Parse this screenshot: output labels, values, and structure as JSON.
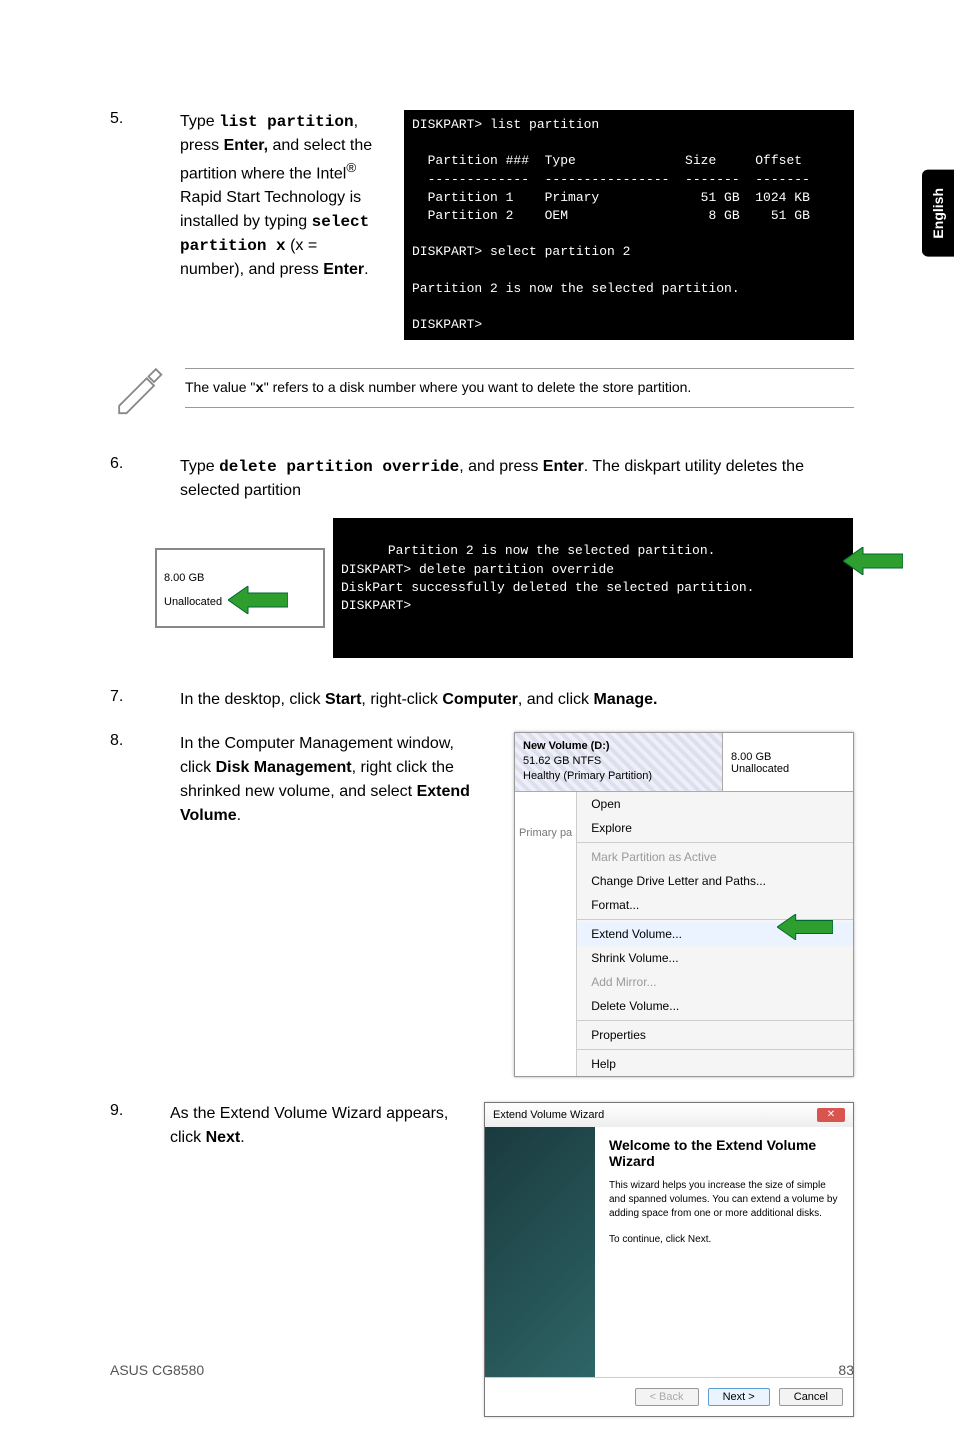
{
  "side_tab": "English",
  "step5": {
    "num": "5.",
    "text_pre": "Type ",
    "cmd1": "list partition",
    "text_mid1": ", press ",
    "bold_enter1": "Enter,",
    "text_mid2": " and select the partition where the Intel",
    "reg": "®",
    "text_mid3": " Rapid Start Technology is installed by typing ",
    "cmd2": "select partition x",
    "text_mid4": " (x = number), and press ",
    "bold_enter2": "Enter",
    "text_end": "."
  },
  "console1": "DISKPART> list partition\n\n  Partition ###  Type              Size     Offset\n  -------------  ----------------  -------  -------\n  Partition 1    Primary             51 GB  1024 KB\n  Partition 2    OEM                  8 GB    51 GB\n\nDISKPART> select partition 2\n\nPartition 2 is now the selected partition.\n\nDISKPART>",
  "note": {
    "pre": "The value \"",
    "x": "x",
    "post": "\" refers to a disk number where you want to delete the store partition."
  },
  "step6": {
    "num": "6.",
    "text_pre": "Type ",
    "cmd": "delete partition override",
    "text_mid1": ", and press ",
    "bold_enter": "Enter",
    "text_end": ". The diskpart utility deletes the selected partition"
  },
  "disk_box": {
    "size": "8.00 GB",
    "state": "Unallocated"
  },
  "console2": "Partition 2 is now the selected partition.\nDISKPART> delete partition override\nDiskPart successfully deleted the selected partition.\nDISKPART>",
  "step7": {
    "num": "7.",
    "pre": "In the desktop, click ",
    "b1": "Start",
    "mid1": ", right-click ",
    "b2": "Computer",
    "mid2": ", and click ",
    "b3": "Manage."
  },
  "step8": {
    "num": "8.",
    "pre": "In the Computer Management window, click ",
    "b1": "Disk Management",
    "mid1": ", right click the shrinked new volume, and select ",
    "b2": "Extend Volume",
    "end": "."
  },
  "ctx": {
    "vol_name": "New Volume (D:)",
    "vol_size": "51.62 GB NTFS",
    "vol_status": "Healthy (Primary Partition)",
    "unalloc_size": "8.00 GB",
    "unalloc_label": "Unallocated",
    "primary": "Primary pa",
    "items": {
      "open": "Open",
      "explore": "Explore",
      "mark_active": "Mark Partition as Active",
      "change_letter": "Change Drive Letter and Paths...",
      "format": "Format...",
      "extend": "Extend Volume...",
      "shrink": "Shrink Volume...",
      "add_mirror": "Add Mirror...",
      "delete": "Delete Volume...",
      "properties": "Properties",
      "help": "Help"
    }
  },
  "step9": {
    "num": "9.",
    "pre": "As the Extend Volume Wizard appears, click ",
    "b1": "Next",
    "end": "."
  },
  "wizard": {
    "title": "Extend Volume Wizard",
    "heading": "Welcome to the Extend Volume Wizard",
    "para": "This wizard helps you increase the size of simple and spanned volumes. You can extend a volume by adding space from one or more additional disks.",
    "continue": "To continue, click Next.",
    "btn_back": "< Back",
    "btn_next": "Next >",
    "btn_cancel": "Cancel"
  },
  "footer": {
    "left": "ASUS CG8580",
    "right": "83"
  }
}
